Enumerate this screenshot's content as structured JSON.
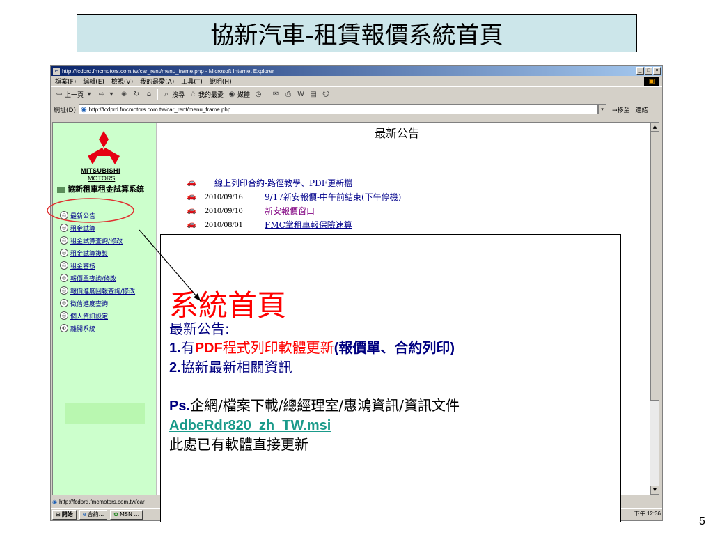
{
  "slide": {
    "title": "協新汽車-租賃報價系統首頁",
    "number": "5"
  },
  "browser": {
    "window_title": "http://fcdprd.fmcmotors.com.tw/car_rent/menu_frame.php - Microsoft Internet Explorer",
    "menu": [
      "檔案(F)",
      "編輯(E)",
      "檢視(V)",
      "我的最愛(A)",
      "工具(T)",
      "說明(H)"
    ],
    "toolbar": {
      "back": "上一頁",
      "search": "搜尋",
      "favorites": "我的最愛",
      "media": "媒體"
    },
    "address": {
      "label": "網址(D)",
      "value": "http://fcdprd.fmcmotors.com.tw/car_rent/menu_frame.php",
      "go": "移至",
      "links": "連結"
    },
    "status_text": "http://fcdprd.fmcmotors.com.tw/car",
    "taskbar": {
      "start": "開始",
      "tasks": [
        "合約...",
        "MSN ..."
      ],
      "clock": "下午 12:36"
    }
  },
  "left_frame": {
    "logo_line1": "MITSUBISHI",
    "logo_line2": "MOTORS",
    "heading": "協新租車租金試算系統",
    "nav_items": [
      "最新公告",
      "租金試算",
      "租金試算查詢/修改",
      "租金試算複製",
      "租金審核",
      "報價單查詢/修改",
      "報價進度回報查詢/修改",
      "徵信進度查詢",
      "個人資訊設定",
      "離開系統"
    ]
  },
  "right_frame": {
    "heading": "最新公告",
    "news": [
      {
        "date": "",
        "text": "線上列印合約-路徑教學、PDF更新檔"
      },
      {
        "date": "2010/09/16",
        "text": "9/17新安報價-中午前結束(下午停機)"
      },
      {
        "date": "2010/09/10",
        "text": "新安報價窗口"
      },
      {
        "date": "2010/08/01",
        "text": "FMC掌租車報保險速算"
      }
    ]
  },
  "callout": {
    "title": "系統首頁",
    "line1": "最新公告:",
    "item1_prefix": "1.",
    "item1_a": "有",
    "item1_b": "PDF",
    "item1_c": "程式列印軟體更新",
    "item1_d": "(報價單、合約列印)",
    "item2_prefix": "2.",
    "item2_text": "協新最新相關資訊",
    "ps_label": "Ps.",
    "ps_text": "企網/檔案下載/總經理室/惠鴻資訊/資訊文件",
    "ps_link": "AdbeRdr820_zh_TW.msi",
    "ps_note": "此處已有軟體直接更新"
  },
  "colors": {
    "title_bg": "#cce6ea",
    "left_frame_bg": "#ccffcc",
    "callout_title": "#ff0000",
    "callout_text": "#000080",
    "annotation_circle": "#e03030"
  }
}
